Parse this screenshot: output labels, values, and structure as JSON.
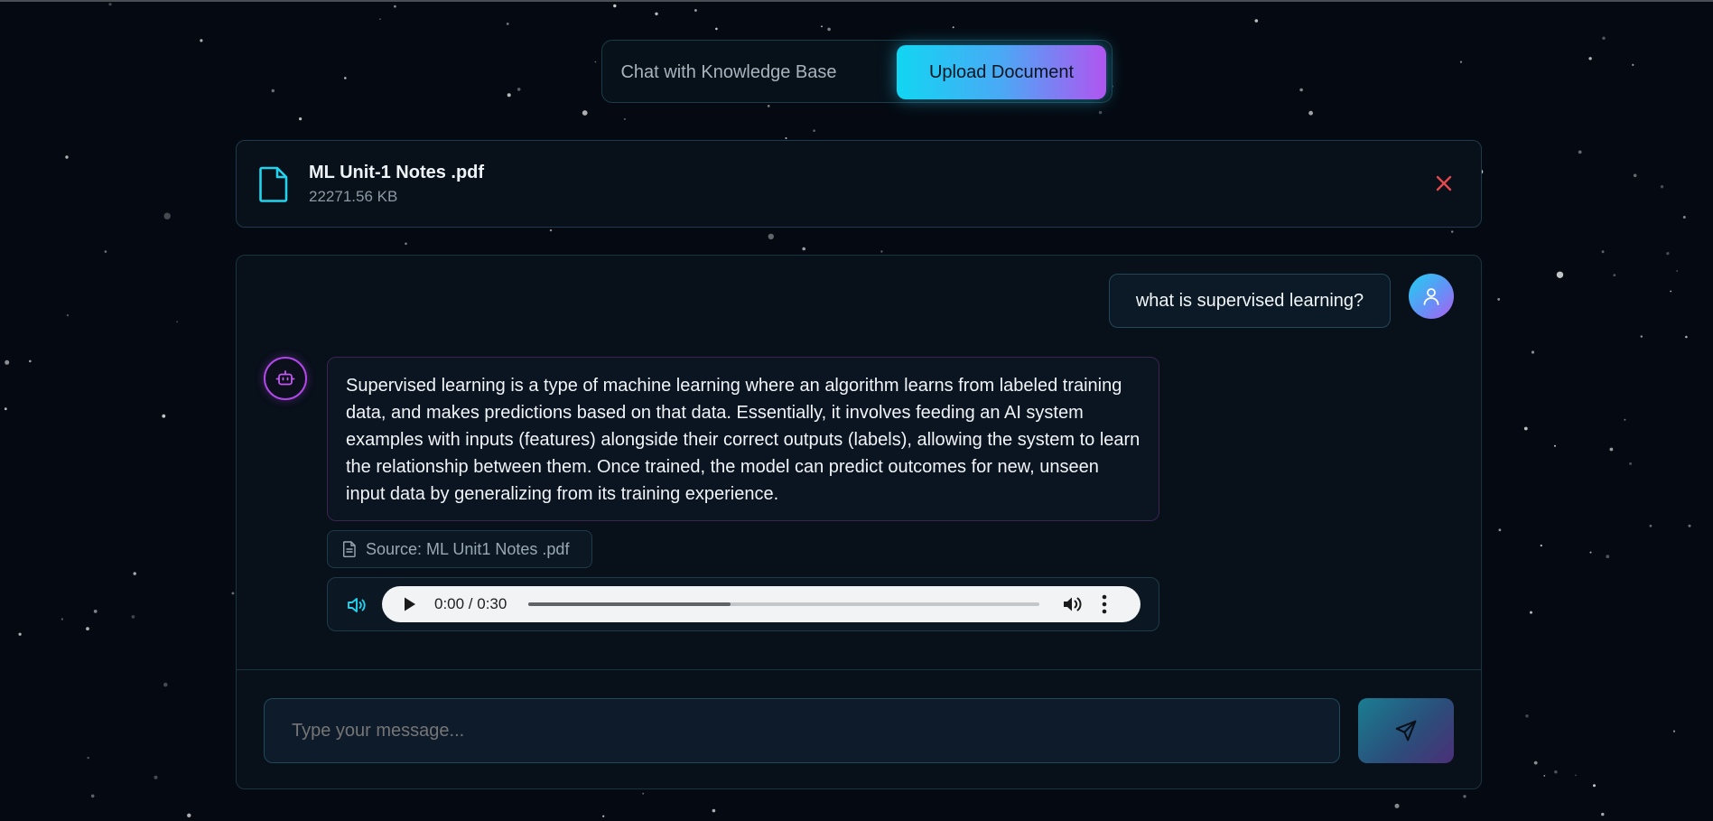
{
  "tabs": {
    "chat_label": "Chat with Knowledge Base",
    "upload_label": "Upload Document",
    "active": "Upload Document"
  },
  "file": {
    "name": "ML Unit-1 Notes .pdf",
    "size": "22271.56 KB",
    "icon": "file-icon",
    "remove_icon": "close-icon"
  },
  "chat": {
    "messages": [
      {
        "role": "user",
        "text": "what is supervised learning?",
        "avatar_icon": "user-icon"
      },
      {
        "role": "assistant",
        "avatar_icon": "bot-icon",
        "text": "Supervised learning is a type of machine learning where an algorithm learns from labeled training data, and makes predictions based on that data. Essentially, it involves feeding an AI system examples with inputs (features) alongside their correct outputs (labels), allowing the system to learn the relationship between them. Once trained, the model can predict outcomes for new, unseen input data by generalizing from its training experience.",
        "source": "Source: ML Unit1 Notes .pdf",
        "audio": {
          "time": "0:00 / 0:30",
          "progress_fraction": 0.395
        }
      }
    ]
  },
  "composer": {
    "placeholder": "Type your message...",
    "send_icon": "send-icon"
  },
  "colors": {
    "background": "#050a12",
    "accent_cyan": "#11d6f2",
    "accent_purple": "#b055f0",
    "danger": "#e5484d"
  }
}
